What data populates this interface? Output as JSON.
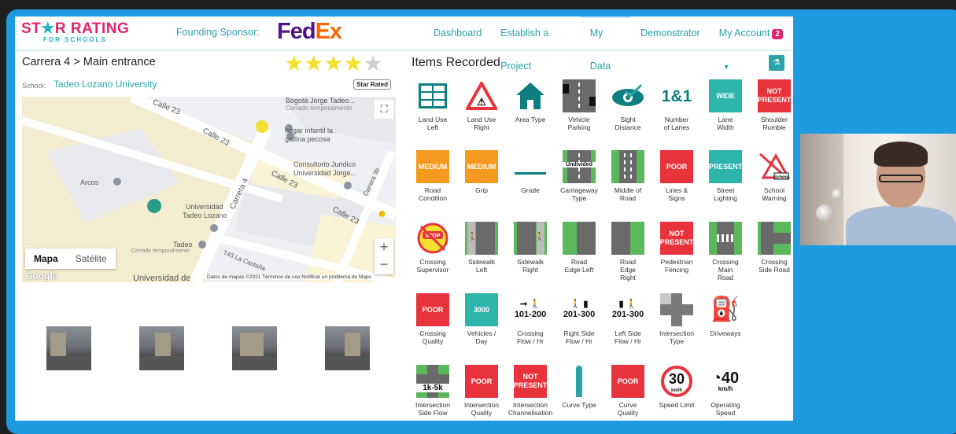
{
  "nav": {
    "logo_line1_a": "ST",
    "logo_line1_b": "R RATING",
    "logo_line2": "FOR SCHOOLS",
    "sponsor_label": "Founding Sponsor:",
    "sponsor_fd": "Fed",
    "sponsor_ex": "Ex",
    "links": [
      "Dashboard",
      "Establish a Project",
      "My Data",
      "Demonstrator",
      "My Account"
    ],
    "account_badge": "2"
  },
  "location": {
    "title": "Carrera 4 > Main entrance",
    "star_rating": 4,
    "star_max": 5,
    "school_label": "School:",
    "school_name": "Tadeo Lozano University",
    "star_rated_label": "Star Rated"
  },
  "map": {
    "labels": {
      "bogota": "Bogotá Jorge Tadeo...",
      "bogota_sub": "Cerrado temporalmente",
      "hogar1": "hogar infantil la",
      "hogar2": "gallina pecosa",
      "consultorio1": "Consultorio Juridico",
      "consultorio2": "Universidad Jorge...",
      "arcos": "Arcos",
      "univ1": "Universidad",
      "univ2": "Tadeo Lozano",
      "tadeo": "Tadeo",
      "tadeo_sub": "Cerrado temporalmente",
      "calle23a": "Calle 23",
      "calle23b": "Calle 23",
      "calle23c": "Calle 23",
      "calle23d": "Calle 23",
      "carrera4": "Carrera 4",
      "carrera3b": "Carrera 3b",
      "t43": "T43 La Castaña",
      "univ_bottom": "Universidad de"
    },
    "type_map": "Mapa",
    "type_sat": "Satélite",
    "footer": "Datos de mapas ©2021   Términos de uso   Notificar un problema de Maps",
    "google": "Google"
  },
  "items_title": "Items Recorded",
  "items": [
    {
      "label": "Land Use\nLeft",
      "badge": ""
    },
    {
      "label": "Land Use\nRight",
      "badge": ""
    },
    {
      "label": "Area Type",
      "badge": ""
    },
    {
      "label": "Vehicle\nParking",
      "badge": ""
    },
    {
      "label": "Sight\nDistance",
      "badge": ""
    },
    {
      "label": "Number\nof Lanes",
      "badge": "1&1"
    },
    {
      "label": "Lane\nWidth",
      "badge": "WIDE"
    },
    {
      "label": "Shoulder\nRumble",
      "badge": "NOT\nPRESENT"
    },
    {
      "label": "Road\nCondition",
      "badge": "MEDIUM"
    },
    {
      "label": "Grip",
      "badge": "MEDIUM"
    },
    {
      "label": "Grade",
      "badge": ""
    },
    {
      "label": "Carriageway\nType",
      "badge": "Undivided"
    },
    {
      "label": "Middle of\nRoad",
      "badge": ""
    },
    {
      "label": "Lines &\nSigns",
      "badge": "POOR"
    },
    {
      "label": "Street\nLighting",
      "badge": "PRESENT"
    },
    {
      "label": "School\nWarning",
      "badge": "School"
    },
    {
      "label": "Crossing\nSupervisor",
      "badge": "STOP"
    },
    {
      "label": "Sidewalk\nLeft",
      "badge": ""
    },
    {
      "label": "Sidewalk\nRight",
      "badge": ""
    },
    {
      "label": "Road\nEdge Left",
      "badge": ""
    },
    {
      "label": "Road\nEdge\nRight",
      "badge": ""
    },
    {
      "label": "Pedestrian\nFencing",
      "badge": "NOT\nPRESENT"
    },
    {
      "label": "Crossing\nMain\nRoad",
      "badge": ""
    },
    {
      "label": "Crossing\nSide Road",
      "badge": ""
    },
    {
      "label": "Crossing\nQuality",
      "badge": "POOR"
    },
    {
      "label": "Vehicles /\nDay",
      "badge": "3000"
    },
    {
      "label": "Crossing\nFlow / Hr",
      "badge": "101-200"
    },
    {
      "label": "Right Side\nFlow / Hr",
      "badge": "201-300"
    },
    {
      "label": "Left Side\nFlow / Hr",
      "badge": "201-300"
    },
    {
      "label": "Intersection\nType",
      "badge": ""
    },
    {
      "label": "Driveways",
      "badge": ""
    },
    {
      "label": "",
      "badge": ""
    },
    {
      "label": "Intersection\nSide Flow",
      "badge": "1k-5k"
    },
    {
      "label": "Intersection\nQuality",
      "badge": "POOR"
    },
    {
      "label": "Intersection\nChannelisation",
      "badge": "NOT\nPRESENT"
    },
    {
      "label": "Curve Type",
      "badge": ""
    },
    {
      "label": "Curve\nQuality",
      "badge": "POOR"
    },
    {
      "label": "Speed Limit",
      "badge": "30"
    },
    {
      "label": "Operating\nSpeed",
      "badge": "40"
    },
    {
      "label": "",
      "badge": ""
    }
  ],
  "speed_unit": "km/h"
}
